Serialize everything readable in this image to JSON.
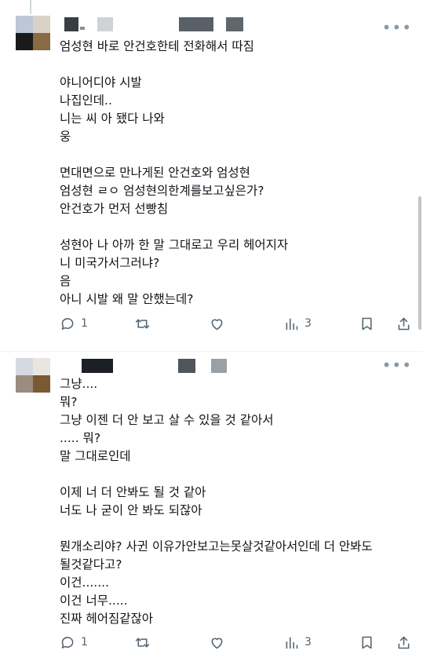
{
  "posts": [
    {
      "lines": [
        "엄성현 바로 안건호한테 전화해서 따짐",
        "",
        "야니어디야 시발",
        "나집인데..",
        "니는 씨 아 됐다 나와",
        "웅",
        "",
        "면대면으로 만나게된 안건호와 엄성현",
        "엄성현 ㄹㅇ 엄성현의한계를보고싶은가?",
        "안건호가 먼저 선빵침",
        "",
        "성현아 나 아까 한 말 그대로고 우리 헤어지자",
        "니 미국가서그러냐?",
        "음",
        "아니 시발 왜 말 안했는데?"
      ],
      "actions": {
        "reply": "1",
        "repost": "",
        "like": "",
        "views": "3"
      }
    },
    {
      "lines": [
        "그냥....",
        "뭐?",
        "그냥 이젠 더 안 보고 살 수 있을 것 같아서",
        "..... 뭐?",
        "말 그대로인데",
        "",
        "이제 너 더 안봐도 될 것 같아",
        "너도 나 굳이 안 봐도 되잖아",
        "",
        "뭔개소리야? 사귄 이유가안보고는못살것같아서인데 더 안봐도",
        "될것같다고?",
        "이건.......",
        "이건 너무.....",
        "진짜 헤어짐같잖아"
      ],
      "actions": {
        "reply": "1",
        "repost": "",
        "like": "",
        "views": "3"
      }
    }
  ],
  "icons": {
    "reply": "reply-icon",
    "repost": "repost-icon",
    "like": "heart-icon",
    "views": "views-icon",
    "bookmark": "bookmark-icon",
    "share": "share-icon",
    "more": "more-icon"
  }
}
